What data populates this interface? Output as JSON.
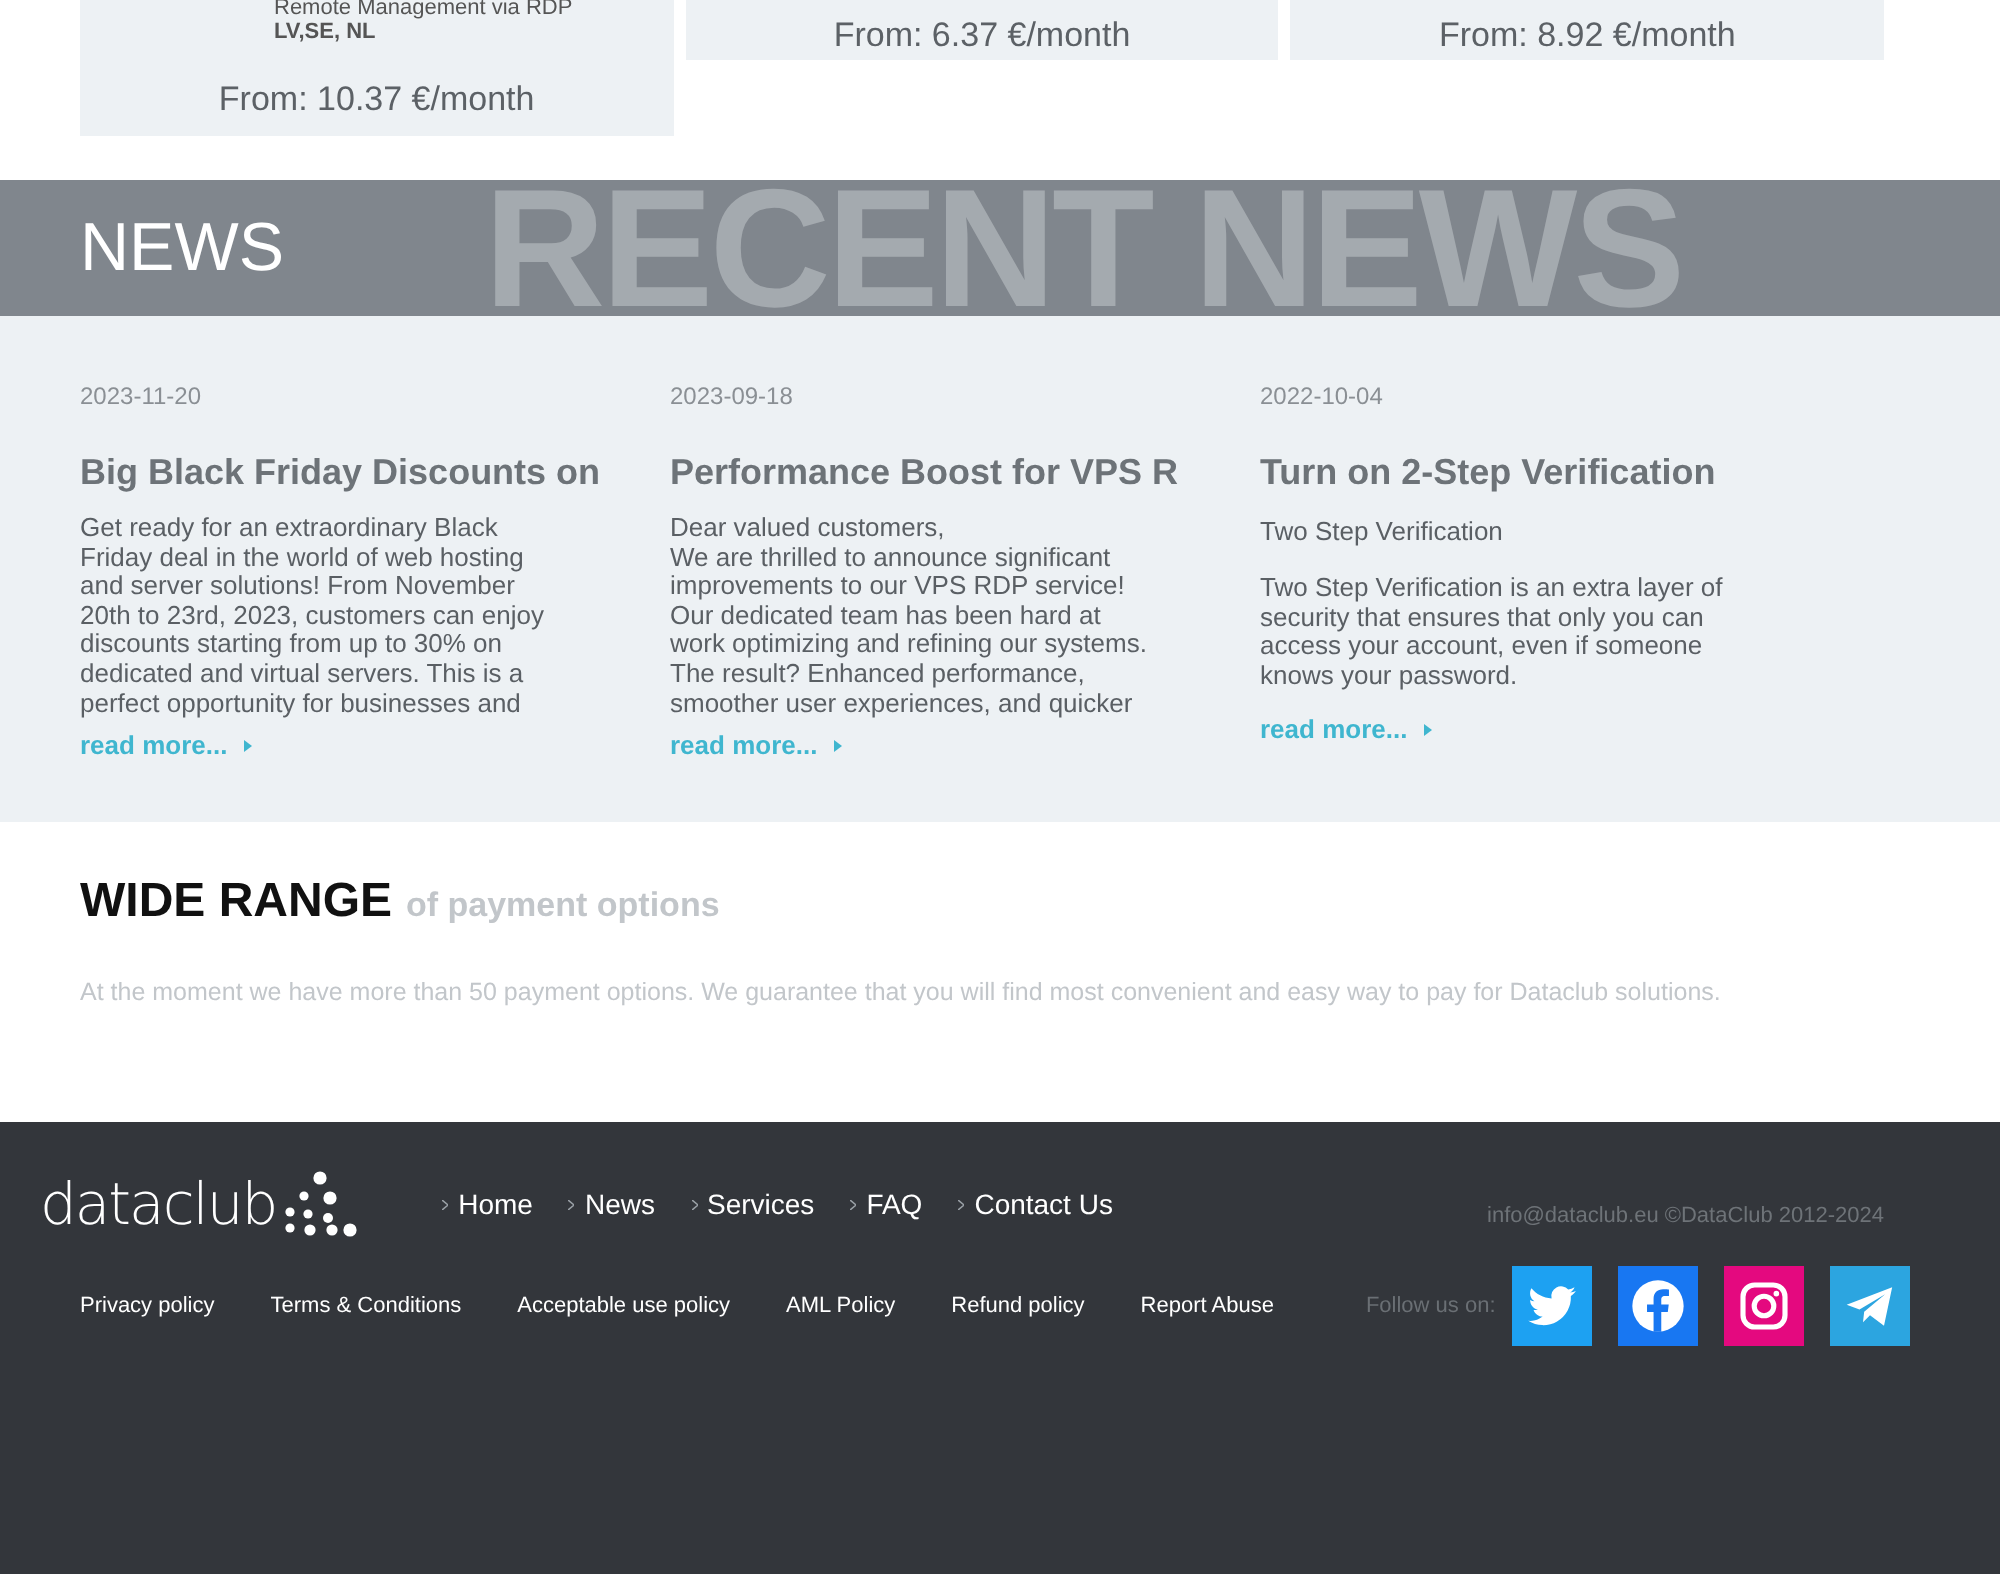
{
  "plans": [
    {
      "lines": [
        "Remote Management via RDP"
      ],
      "locations": "LV,SE, NL",
      "price": "From: 10.37 €/month"
    },
    {
      "price": "From: 6.37 €/month"
    },
    {
      "price": "From: 8.92 €/month"
    }
  ],
  "news_header": {
    "title": "NEWS",
    "backdrop": "RECENT NEWS"
  },
  "news": [
    {
      "date": "2023-11-20",
      "title": "Big Black Friday Discounts on",
      "body": "Get ready for an extraordinary Black Friday deal in the world of web hosting and server solutions! From November 20th to 23rd, 2023, customers can enjoy discounts starting from up to 30% on dedicated and virtual servers. This is a perfect opportunity for businesses and",
      "link": "read more..."
    },
    {
      "date": "2023-09-18",
      "title": "Performance Boost for VPS R",
      "body": "Dear valued customers,\nWe are thrilled to announce significant improvements to our VPS RDP service! Our dedicated team has been hard at work optimizing and refining our systems. The result? Enhanced performance, smoother user experiences, and quicker",
      "link": "read more..."
    },
    {
      "date": "2022-10-04",
      "title": "Turn on 2-Step Verification",
      "subtitle": "Two Step Verification",
      "body": "Two Step Verification is an extra layer of security that ensures that only you can access your account, even if someone knows your password.",
      "link": "read more..."
    }
  ],
  "payment": {
    "title": "WIDE RANGE",
    "subtitle": "of payment options",
    "text": "At the moment we have more than 50 payment options. We guarantee that you will find most convenient and easy way to pay for Dataclub solutions."
  },
  "footer": {
    "logo": "dataclub",
    "nav": [
      "Home",
      "News",
      "Services",
      "FAQ",
      "Contact Us"
    ],
    "contact": "info@dataclub.eu ©DataClub 2012-2024",
    "links": [
      "Privacy policy",
      "Terms & Conditions",
      "Acceptable use policy",
      "AML Policy",
      "Refund policy",
      "Report Abuse"
    ],
    "follow": "Follow us on:",
    "social": [
      {
        "kind": "twitter",
        "color": "#1da1f2"
      },
      {
        "kind": "facebook",
        "color": "#1877f2"
      },
      {
        "kind": "instagram",
        "color": "#e4097f"
      },
      {
        "kind": "telegram",
        "color": "#2ca5e0"
      }
    ]
  }
}
